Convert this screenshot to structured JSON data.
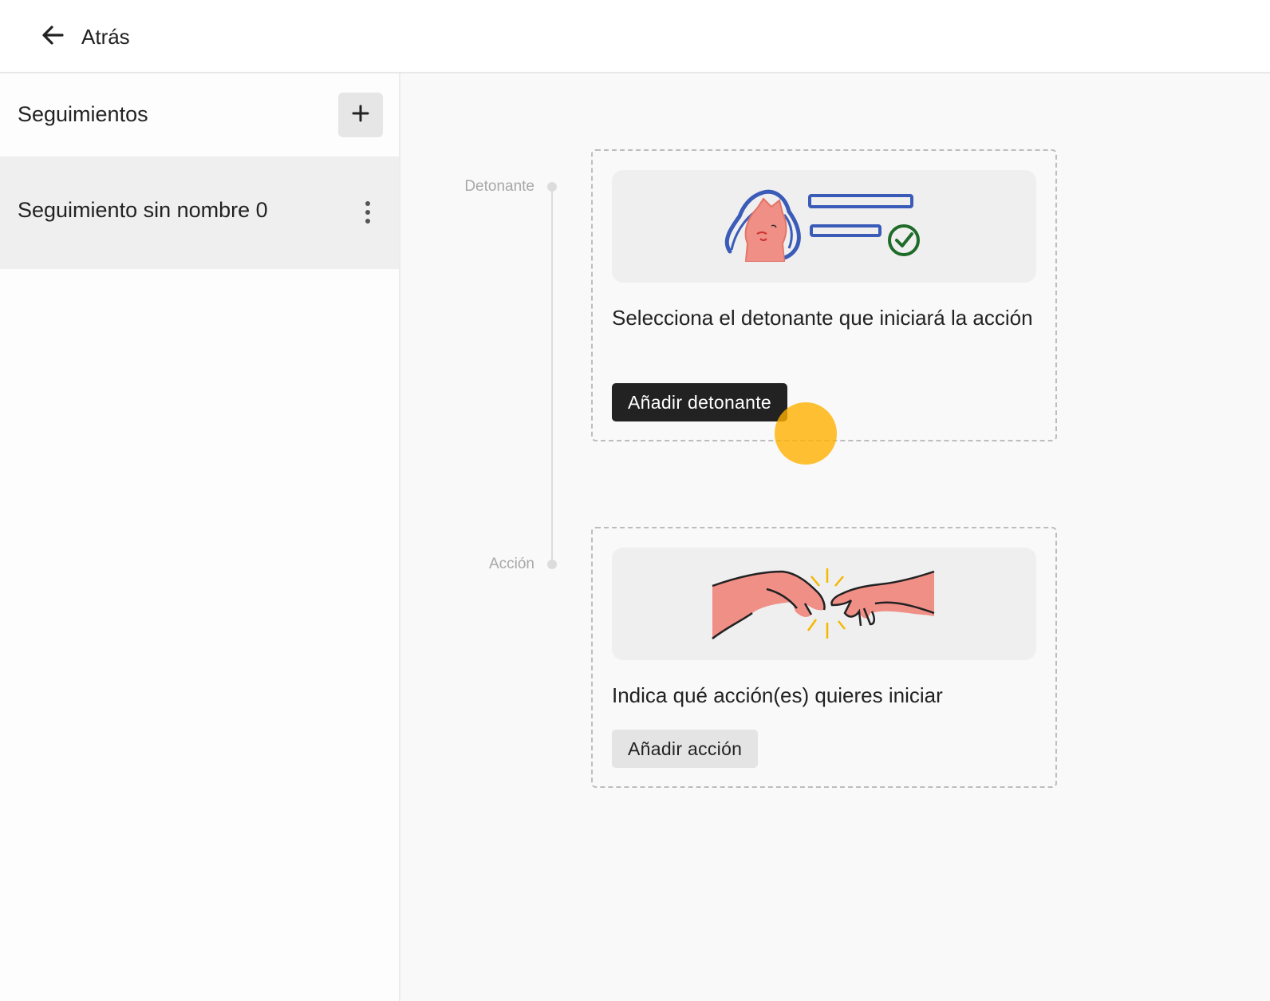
{
  "header": {
    "back_label": "Atrás",
    "back_icon": "arrow-left-icon"
  },
  "sidebar": {
    "title": "Seguimientos",
    "add_icon": "plus-icon",
    "items": [
      {
        "label": "Seguimiento sin nombre 0",
        "menu_icon": "more-vertical-icon",
        "selected": true
      }
    ]
  },
  "timeline": {
    "steps": [
      {
        "label": "Detonante",
        "description": "Selecciona el detonante que iniciará la acción",
        "button_label": "Añadir detonante",
        "illustration": "person-checklist-illustration"
      },
      {
        "label": "Acción",
        "description": "Indica qué acción(es) quieres iniciar",
        "button_label": "Añadir acción",
        "illustration": "hands-touching-illustration"
      }
    ]
  },
  "colors": {
    "primary_button": "#222222",
    "secondary_button": "#e4e4e4",
    "selected_item": "#efefef",
    "cursor_highlight": "#ffb100"
  }
}
